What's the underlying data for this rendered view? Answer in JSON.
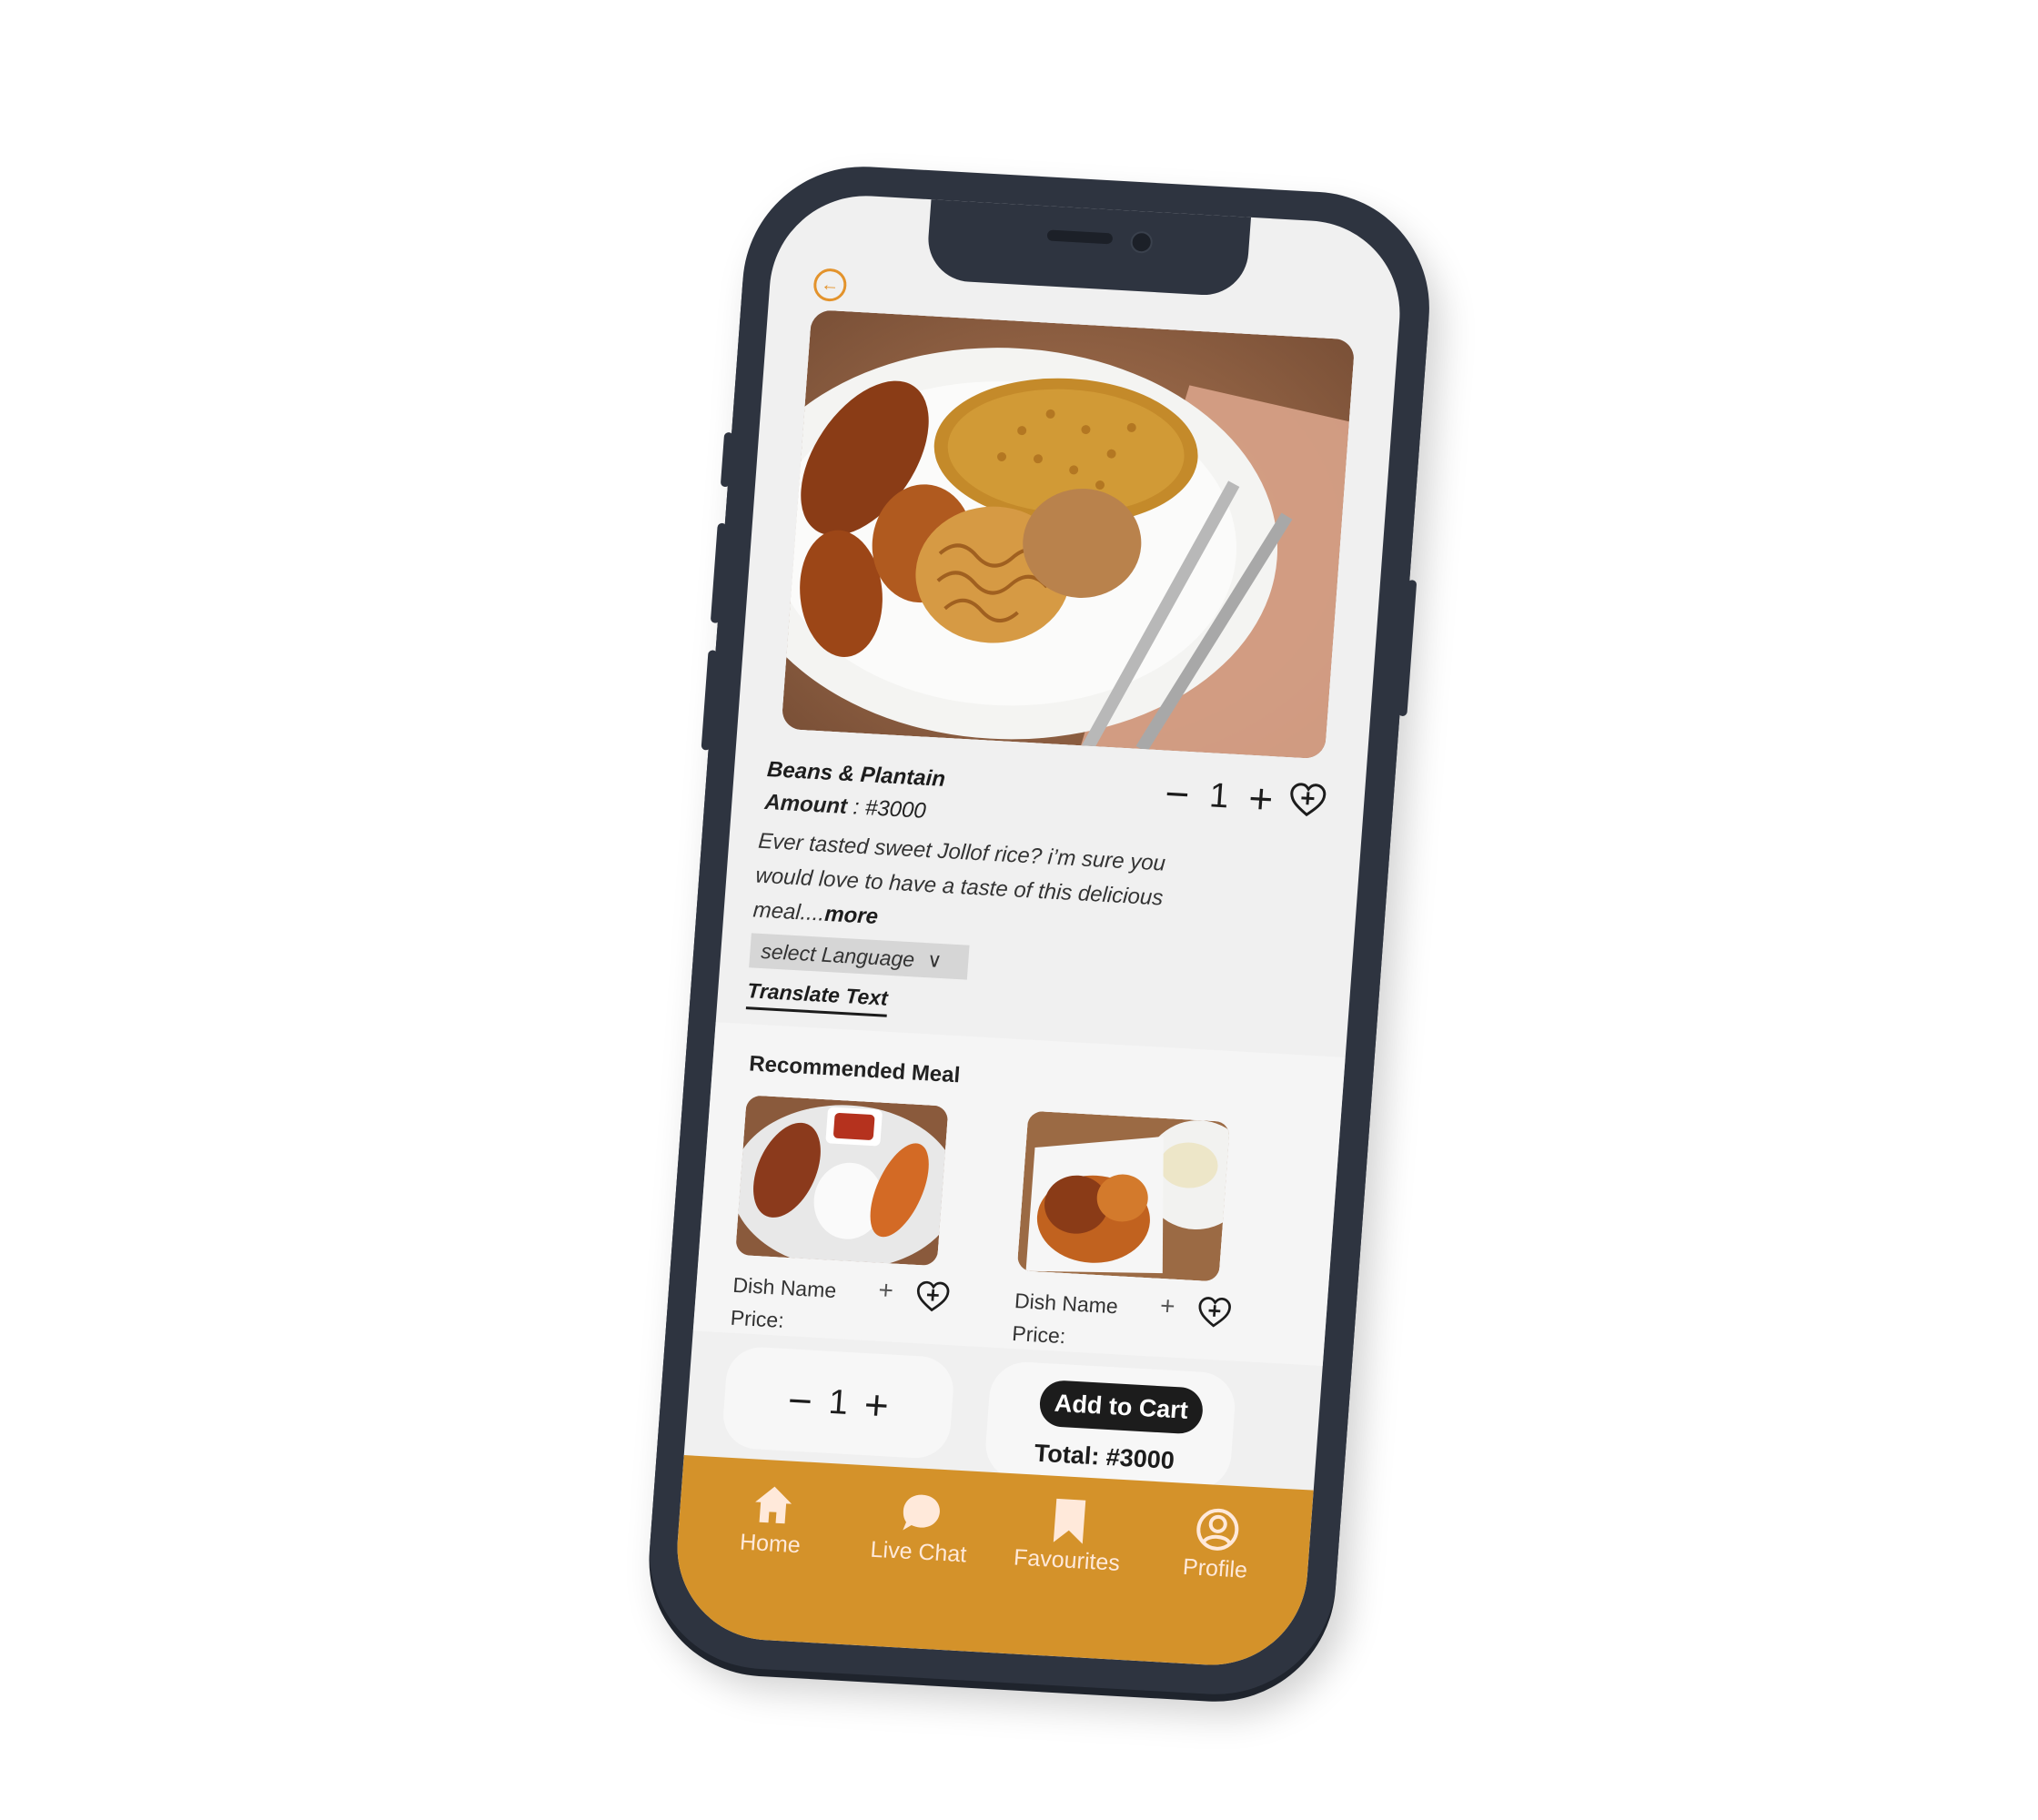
{
  "dish": {
    "title": "Beans & Plantain",
    "amount_label": "Amount",
    "amount_value": " : #3000",
    "description": "Ever tasted sweet Jollof rice? i’m sure you would love to have a taste of this delicious meal....",
    "more_label": "more",
    "quantity": "1",
    "minus_symbol": "−",
    "plus_symbol": "+"
  },
  "language": {
    "select_label": "select Language",
    "translate_label": "Translate Text"
  },
  "recommended": {
    "title": "Recommended Meal",
    "items": [
      {
        "name": "Dish Name",
        "price_label": "Price:",
        "add_symbol": "+"
      },
      {
        "name": "Dish Name",
        "price_label": "Price:",
        "add_symbol": "+"
      }
    ]
  },
  "order": {
    "quantity": "1",
    "minus_symbol": "−",
    "plus_symbol": "+",
    "add_to_cart_label": "Add to Cart",
    "total_label": "Total: #3000"
  },
  "nav": {
    "items": [
      {
        "label": "Home",
        "icon": "home-icon"
      },
      {
        "label": "Live Chat",
        "icon": "chat-bubble-icon"
      },
      {
        "label": "Favourites",
        "icon": "bookmark-icon"
      },
      {
        "label": "Profile",
        "icon": "profile-icon"
      }
    ]
  },
  "colors": {
    "accent": "#e3932c",
    "nav_bar": "#d4922a",
    "device_frame": "#2e3440",
    "screen_bg": "#f0f0f0",
    "nav_text": "#ffe9da"
  }
}
